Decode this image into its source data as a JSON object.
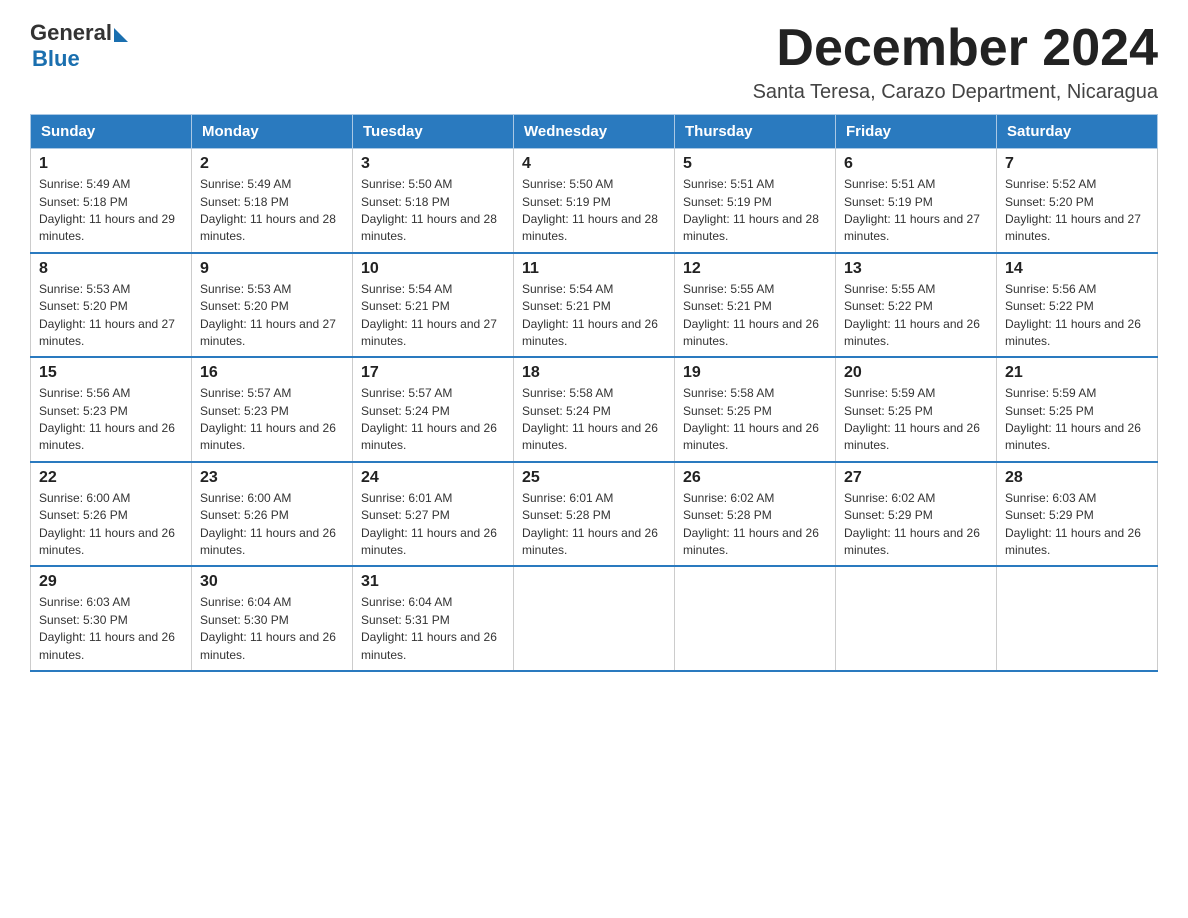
{
  "header": {
    "logo_general": "General",
    "logo_blue": "Blue",
    "main_title": "December 2024",
    "subtitle": "Santa Teresa, Carazo Department, Nicaragua"
  },
  "calendar": {
    "days_of_week": [
      "Sunday",
      "Monday",
      "Tuesday",
      "Wednesday",
      "Thursday",
      "Friday",
      "Saturday"
    ],
    "weeks": [
      [
        {
          "day": "1",
          "sunrise": "Sunrise: 5:49 AM",
          "sunset": "Sunset: 5:18 PM",
          "daylight": "Daylight: 11 hours and 29 minutes."
        },
        {
          "day": "2",
          "sunrise": "Sunrise: 5:49 AM",
          "sunset": "Sunset: 5:18 PM",
          "daylight": "Daylight: 11 hours and 28 minutes."
        },
        {
          "day": "3",
          "sunrise": "Sunrise: 5:50 AM",
          "sunset": "Sunset: 5:18 PM",
          "daylight": "Daylight: 11 hours and 28 minutes."
        },
        {
          "day": "4",
          "sunrise": "Sunrise: 5:50 AM",
          "sunset": "Sunset: 5:19 PM",
          "daylight": "Daylight: 11 hours and 28 minutes."
        },
        {
          "day": "5",
          "sunrise": "Sunrise: 5:51 AM",
          "sunset": "Sunset: 5:19 PM",
          "daylight": "Daylight: 11 hours and 28 minutes."
        },
        {
          "day": "6",
          "sunrise": "Sunrise: 5:51 AM",
          "sunset": "Sunset: 5:19 PM",
          "daylight": "Daylight: 11 hours and 27 minutes."
        },
        {
          "day": "7",
          "sunrise": "Sunrise: 5:52 AM",
          "sunset": "Sunset: 5:20 PM",
          "daylight": "Daylight: 11 hours and 27 minutes."
        }
      ],
      [
        {
          "day": "8",
          "sunrise": "Sunrise: 5:53 AM",
          "sunset": "Sunset: 5:20 PM",
          "daylight": "Daylight: 11 hours and 27 minutes."
        },
        {
          "day": "9",
          "sunrise": "Sunrise: 5:53 AM",
          "sunset": "Sunset: 5:20 PM",
          "daylight": "Daylight: 11 hours and 27 minutes."
        },
        {
          "day": "10",
          "sunrise": "Sunrise: 5:54 AM",
          "sunset": "Sunset: 5:21 PM",
          "daylight": "Daylight: 11 hours and 27 minutes."
        },
        {
          "day": "11",
          "sunrise": "Sunrise: 5:54 AM",
          "sunset": "Sunset: 5:21 PM",
          "daylight": "Daylight: 11 hours and 26 minutes."
        },
        {
          "day": "12",
          "sunrise": "Sunrise: 5:55 AM",
          "sunset": "Sunset: 5:21 PM",
          "daylight": "Daylight: 11 hours and 26 minutes."
        },
        {
          "day": "13",
          "sunrise": "Sunrise: 5:55 AM",
          "sunset": "Sunset: 5:22 PM",
          "daylight": "Daylight: 11 hours and 26 minutes."
        },
        {
          "day": "14",
          "sunrise": "Sunrise: 5:56 AM",
          "sunset": "Sunset: 5:22 PM",
          "daylight": "Daylight: 11 hours and 26 minutes."
        }
      ],
      [
        {
          "day": "15",
          "sunrise": "Sunrise: 5:56 AM",
          "sunset": "Sunset: 5:23 PM",
          "daylight": "Daylight: 11 hours and 26 minutes."
        },
        {
          "day": "16",
          "sunrise": "Sunrise: 5:57 AM",
          "sunset": "Sunset: 5:23 PM",
          "daylight": "Daylight: 11 hours and 26 minutes."
        },
        {
          "day": "17",
          "sunrise": "Sunrise: 5:57 AM",
          "sunset": "Sunset: 5:24 PM",
          "daylight": "Daylight: 11 hours and 26 minutes."
        },
        {
          "day": "18",
          "sunrise": "Sunrise: 5:58 AM",
          "sunset": "Sunset: 5:24 PM",
          "daylight": "Daylight: 11 hours and 26 minutes."
        },
        {
          "day": "19",
          "sunrise": "Sunrise: 5:58 AM",
          "sunset": "Sunset: 5:25 PM",
          "daylight": "Daylight: 11 hours and 26 minutes."
        },
        {
          "day": "20",
          "sunrise": "Sunrise: 5:59 AM",
          "sunset": "Sunset: 5:25 PM",
          "daylight": "Daylight: 11 hours and 26 minutes."
        },
        {
          "day": "21",
          "sunrise": "Sunrise: 5:59 AM",
          "sunset": "Sunset: 5:25 PM",
          "daylight": "Daylight: 11 hours and 26 minutes."
        }
      ],
      [
        {
          "day": "22",
          "sunrise": "Sunrise: 6:00 AM",
          "sunset": "Sunset: 5:26 PM",
          "daylight": "Daylight: 11 hours and 26 minutes."
        },
        {
          "day": "23",
          "sunrise": "Sunrise: 6:00 AM",
          "sunset": "Sunset: 5:26 PM",
          "daylight": "Daylight: 11 hours and 26 minutes."
        },
        {
          "day": "24",
          "sunrise": "Sunrise: 6:01 AM",
          "sunset": "Sunset: 5:27 PM",
          "daylight": "Daylight: 11 hours and 26 minutes."
        },
        {
          "day": "25",
          "sunrise": "Sunrise: 6:01 AM",
          "sunset": "Sunset: 5:28 PM",
          "daylight": "Daylight: 11 hours and 26 minutes."
        },
        {
          "day": "26",
          "sunrise": "Sunrise: 6:02 AM",
          "sunset": "Sunset: 5:28 PM",
          "daylight": "Daylight: 11 hours and 26 minutes."
        },
        {
          "day": "27",
          "sunrise": "Sunrise: 6:02 AM",
          "sunset": "Sunset: 5:29 PM",
          "daylight": "Daylight: 11 hours and 26 minutes."
        },
        {
          "day": "28",
          "sunrise": "Sunrise: 6:03 AM",
          "sunset": "Sunset: 5:29 PM",
          "daylight": "Daylight: 11 hours and 26 minutes."
        }
      ],
      [
        {
          "day": "29",
          "sunrise": "Sunrise: 6:03 AM",
          "sunset": "Sunset: 5:30 PM",
          "daylight": "Daylight: 11 hours and 26 minutes."
        },
        {
          "day": "30",
          "sunrise": "Sunrise: 6:04 AM",
          "sunset": "Sunset: 5:30 PM",
          "daylight": "Daylight: 11 hours and 26 minutes."
        },
        {
          "day": "31",
          "sunrise": "Sunrise: 6:04 AM",
          "sunset": "Sunset: 5:31 PM",
          "daylight": "Daylight: 11 hours and 26 minutes."
        },
        null,
        null,
        null,
        null
      ]
    ]
  }
}
